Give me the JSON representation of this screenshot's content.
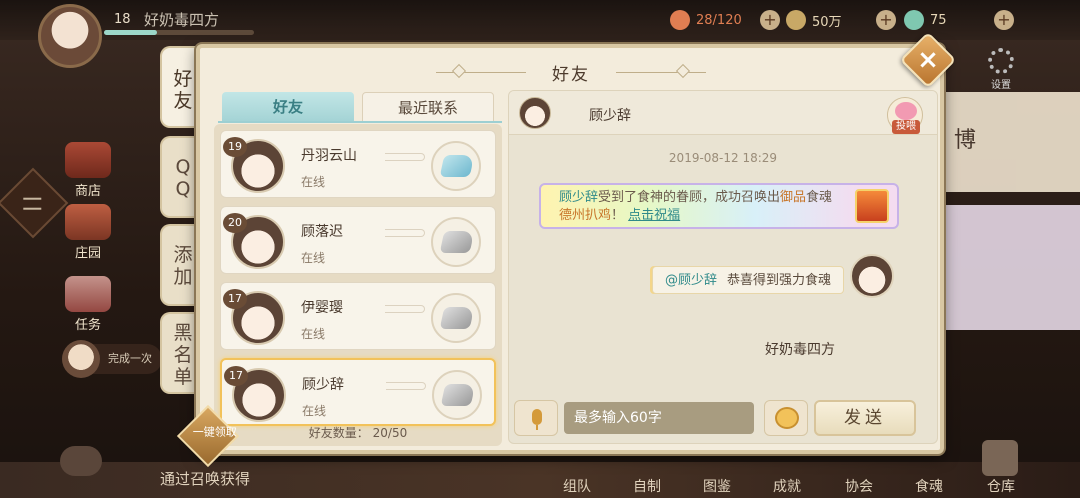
{
  "hud": {
    "player_level": "18",
    "player_name": "好奶毒四方",
    "food": "28/120",
    "coins": "50万",
    "jade": "75",
    "settings_label": "设置"
  },
  "left_menu": {
    "shop": "商店",
    "garden": "庄园",
    "tasks": "任务",
    "complete_task": "完成一次"
  },
  "right_cards": {
    "card1": "博"
  },
  "bottom": {
    "message": "通过召唤获得",
    "nav": [
      "组队",
      "自制",
      "图鉴",
      "成就",
      "协会",
      "食魂",
      "仓库"
    ]
  },
  "panel": {
    "title": "好友",
    "close": "×",
    "vtabs": [
      "好友",
      "QQ",
      "添加",
      "黑名单"
    ],
    "subtabs": {
      "friends": "好友",
      "recent": "最近联系"
    }
  },
  "friends": [
    {
      "level": "19",
      "name": "丹羽云山",
      "status": "在线",
      "gift": "blue"
    },
    {
      "level": "20",
      "name": "顾落迟",
      "status": "在线",
      "gift": "grey"
    },
    {
      "level": "17",
      "name": "伊婴璎",
      "status": "在线",
      "gift": "grey"
    },
    {
      "level": "17",
      "name": "顾少辞",
      "status": "在线",
      "gift": "grey"
    }
  ],
  "friend_count_label": "好友数量：",
  "friend_count": "20/50",
  "claim_all": "一键领取",
  "chat": {
    "partner_name": "顾少辞",
    "gift_label": "投喂",
    "timestamp": "2019-08-12  18:29",
    "system_message": {
      "name": "顾少辞",
      "text1": "受到了食神的眷顾，成功召唤出",
      "highlight": "御品",
      "text2": "食魂",
      "soul": "德州扒鸡",
      "text3": "！",
      "link": "点击祝福"
    },
    "my_name": "好奶毒四方",
    "my_message_at": "@顾少辞",
    "my_message": "恭喜得到强力食魂",
    "input_placeholder": "最多输入60字",
    "send": "发送"
  }
}
